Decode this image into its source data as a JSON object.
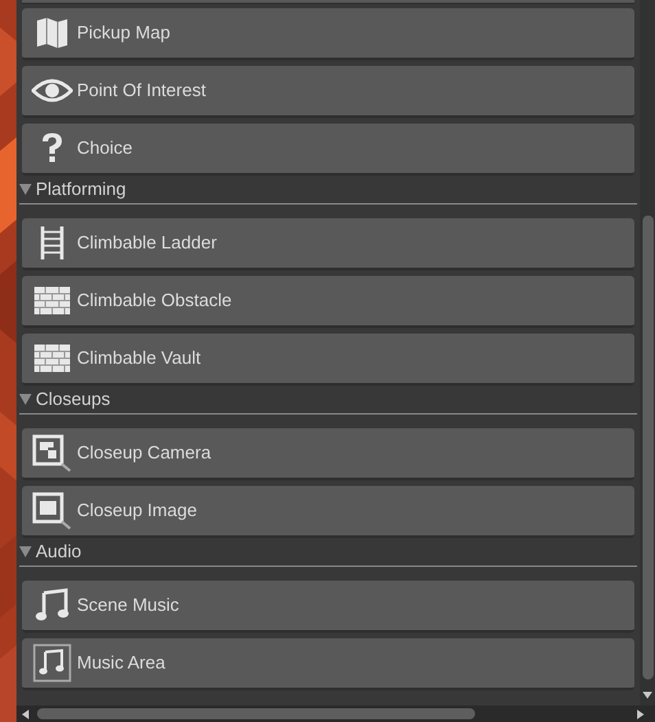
{
  "groups": [
    {
      "items": [
        {
          "label": "Pickup Map",
          "kind": "map"
        },
        {
          "label": "Point Of Interest",
          "kind": "eye"
        },
        {
          "label": "Choice",
          "kind": "question"
        }
      ]
    },
    {
      "title": "Platforming",
      "expanded": true,
      "items": [
        {
          "label": "Climbable Ladder",
          "kind": "ladder"
        },
        {
          "label": "Climbable Obstacle",
          "kind": "bricks"
        },
        {
          "label": "Climbable Vault",
          "kind": "bricks"
        }
      ]
    },
    {
      "title": "Closeups",
      "expanded": true,
      "items": [
        {
          "label": "Closeup Camera",
          "kind": "framed"
        },
        {
          "label": "Closeup Image",
          "kind": "picture"
        }
      ]
    },
    {
      "title": "Audio",
      "expanded": true,
      "items": [
        {
          "label": "Scene Music",
          "kind": "note"
        },
        {
          "label": "Music Area",
          "kind": "notebox"
        }
      ]
    }
  ]
}
